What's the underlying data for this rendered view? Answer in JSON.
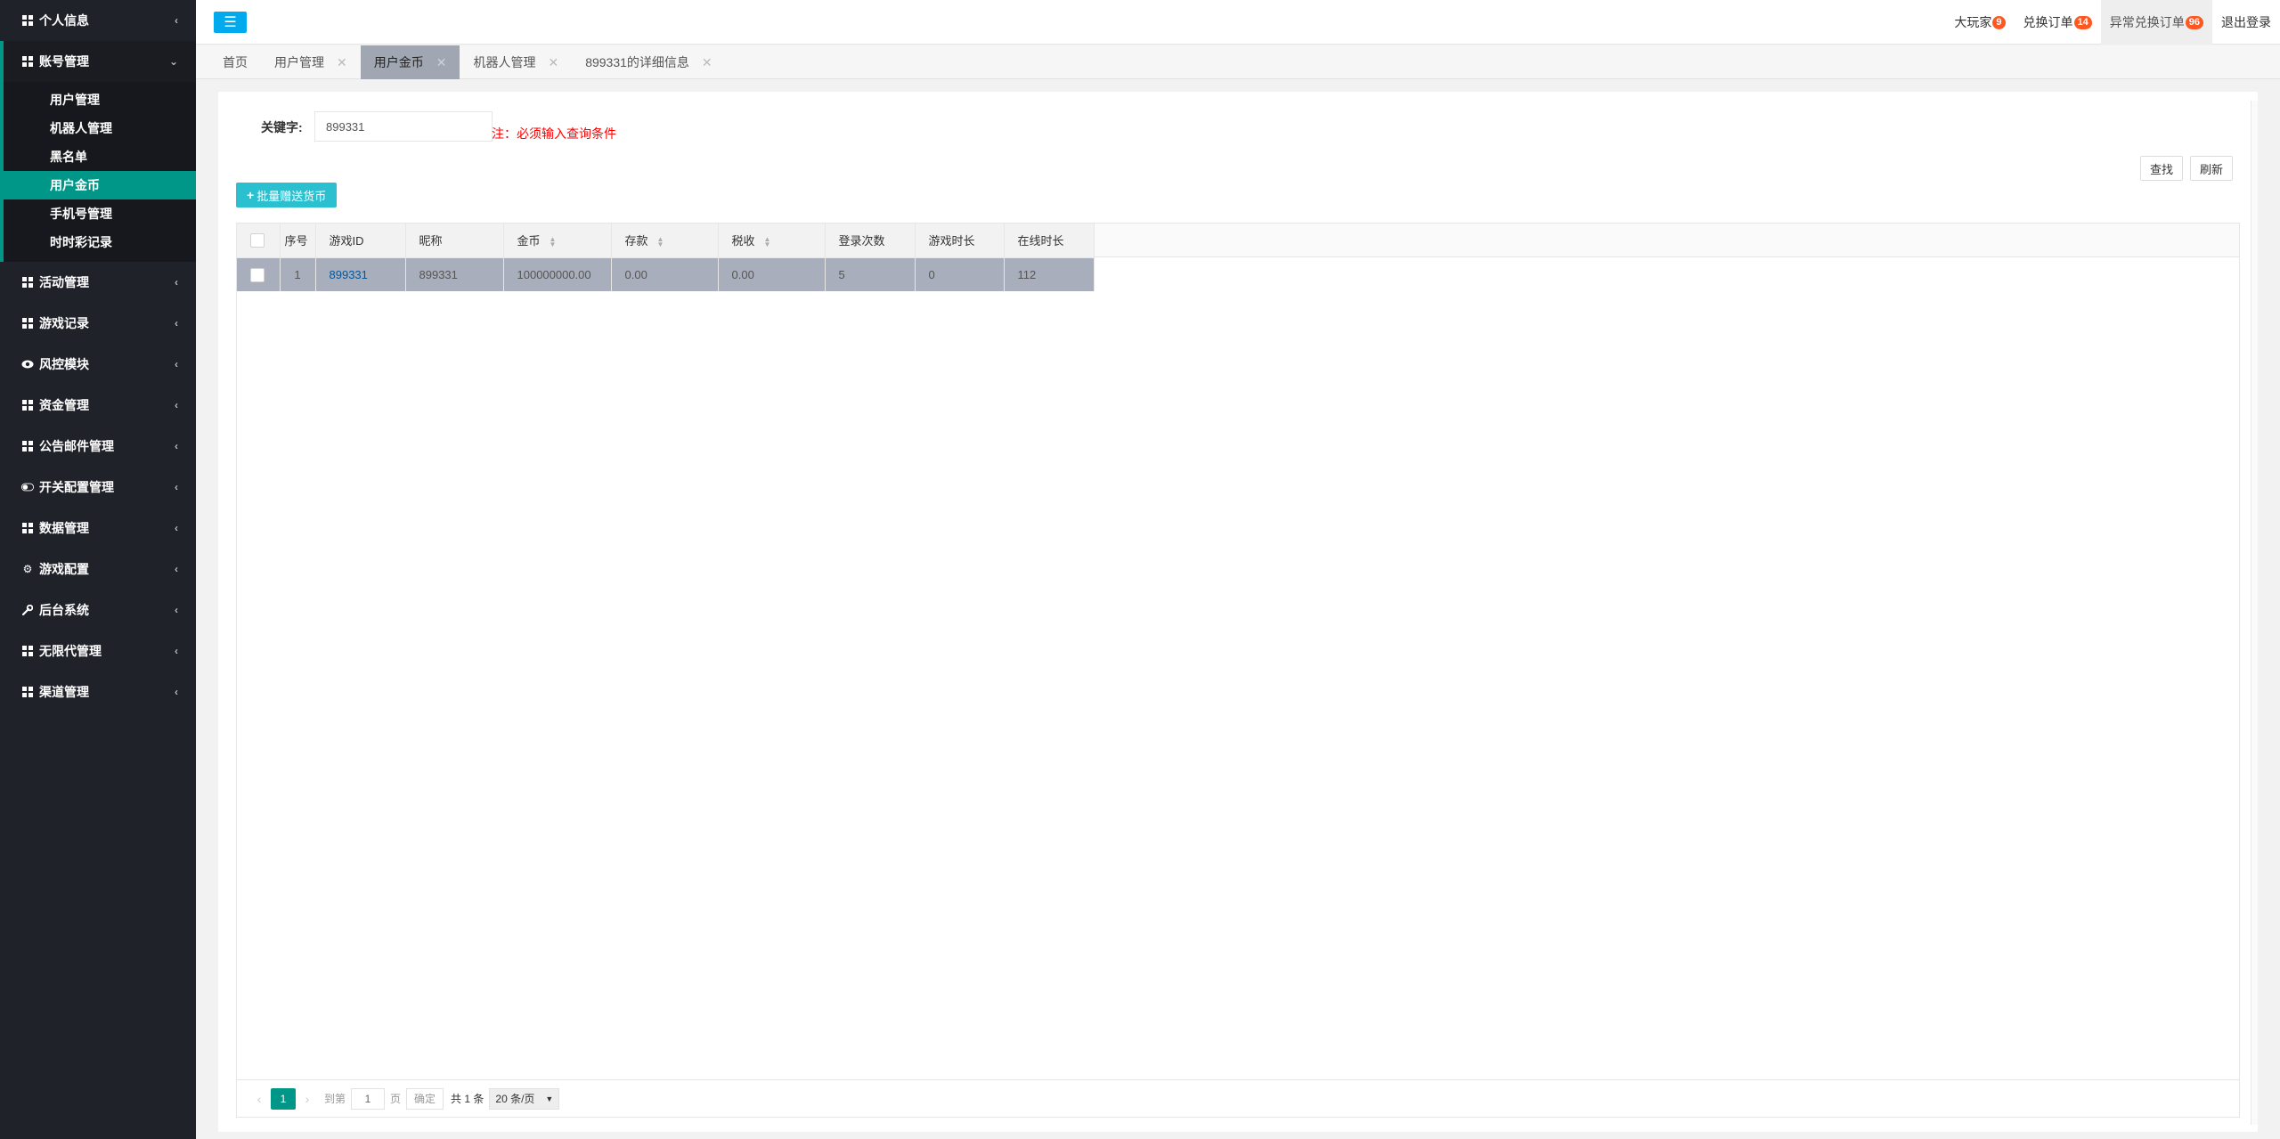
{
  "sidebar": {
    "groups_top": [
      {
        "label": "个人信息",
        "icon": "grid-icon"
      },
      {
        "label": "账号管理",
        "icon": "grid-icon",
        "open": true
      }
    ],
    "sub_items": [
      {
        "label": "用户管理"
      },
      {
        "label": "机器人管理"
      },
      {
        "label": "黑名单"
      },
      {
        "label": "用户金币",
        "active": true
      },
      {
        "label": "手机号管理"
      },
      {
        "label": "时时彩记录"
      }
    ],
    "groups_bottom": [
      {
        "label": "活动管理",
        "icon": "grid-icon"
      },
      {
        "label": "游戏记录",
        "icon": "grid-icon"
      },
      {
        "label": "风控模块",
        "icon": "eye-icon"
      },
      {
        "label": "资金管理",
        "icon": "grid-icon"
      },
      {
        "label": "公告邮件管理",
        "icon": "grid-icon"
      },
      {
        "label": "开关配置管理",
        "icon": "toggle-icon"
      },
      {
        "label": "数据管理",
        "icon": "grid-icon"
      },
      {
        "label": "游戏配置",
        "icon": "gears-icon"
      },
      {
        "label": "后台系统",
        "icon": "wrench-icon"
      },
      {
        "label": "无限代管理",
        "icon": "grid-icon"
      },
      {
        "label": "渠道管理",
        "icon": "grid-icon"
      }
    ]
  },
  "header": {
    "links": [
      {
        "label": "大玩家",
        "badge": "9"
      },
      {
        "label": "兑换订单",
        "badge": "14"
      },
      {
        "label": "异常兑换订单",
        "badge": "96"
      },
      {
        "label": "退出登录",
        "badge": ""
      }
    ]
  },
  "tabs": [
    {
      "label": "首页",
      "closable": false
    },
    {
      "label": "用户管理",
      "closable": true
    },
    {
      "label": "用户金币",
      "closable": true,
      "active": true
    },
    {
      "label": "机器人管理",
      "closable": true
    },
    {
      "label": "899331的详细信息",
      "closable": true
    }
  ],
  "search": {
    "label": "关键字:",
    "value": "899331",
    "note": "注：必须输入查询条件"
  },
  "toolbar": {
    "find_label": "查找",
    "refresh_label": "刷新",
    "batch_label": "批量赠送货币"
  },
  "table": {
    "columns": [
      "序号",
      "游戏ID",
      "昵称",
      "金币",
      "存款",
      "税收",
      "登录次数",
      "游戏时长",
      "在线时长"
    ],
    "rows": [
      [
        "1",
        "899331",
        "899331",
        "100000000.00",
        "0.00",
        "0.00",
        "5",
        "0",
        "112"
      ]
    ]
  },
  "pager": {
    "current_page": "1",
    "goto_label": "到第",
    "goto_value": "1",
    "page_unit": "页",
    "confirm_label": "确定",
    "total_label": "共 1 条",
    "page_size_label": "20 条/页"
  },
  "colors": {
    "sidebar_bg": "#20222a",
    "accent": "#009688",
    "badge": "#ff5722",
    "toggle": "#01aaed",
    "batch_button": "#2bc0d0"
  }
}
